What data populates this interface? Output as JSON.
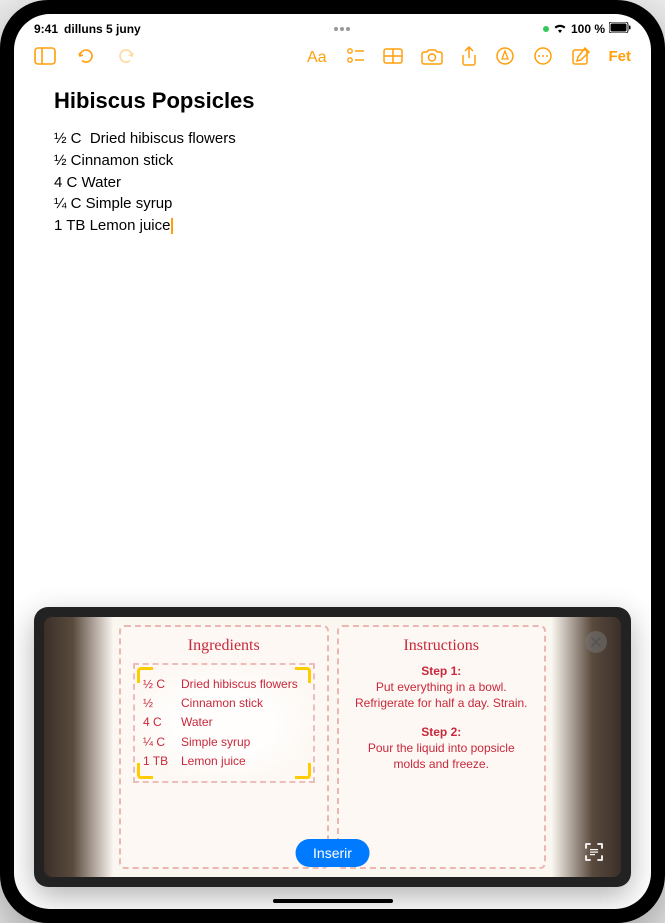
{
  "status": {
    "time": "9:41",
    "date": "dilluns 5 juny",
    "battery": "100 %"
  },
  "toolbar": {
    "done_label": "Fet"
  },
  "note": {
    "title": "Hibiscus Popsicles",
    "lines": [
      "½ C  Dried hibiscus flowers",
      "½ Cinnamon stick",
      "4 C Water",
      "¼ C Simple syrup",
      "1 TB Lemon juice"
    ]
  },
  "scan": {
    "insert_label": "Inserir",
    "ingredients_header": "Ingredients",
    "instructions_header": "Instructions",
    "ingredients": [
      {
        "amt": "½ C",
        "name": "Dried hibiscus flowers"
      },
      {
        "amt": "½",
        "name": "Cinnamon stick"
      },
      {
        "amt": "4  C",
        "name": "Water"
      },
      {
        "amt": "¼ C",
        "name": "Simple syrup"
      },
      {
        "amt": "1 TB",
        "name": "Lemon juice"
      }
    ],
    "steps": [
      {
        "title": "Step 1:",
        "text": "Put everything in a bowl. Refrigerate for half a day. Strain."
      },
      {
        "title": "Step 2:",
        "text": "Pour the liquid into popsicle molds and freeze."
      }
    ]
  }
}
